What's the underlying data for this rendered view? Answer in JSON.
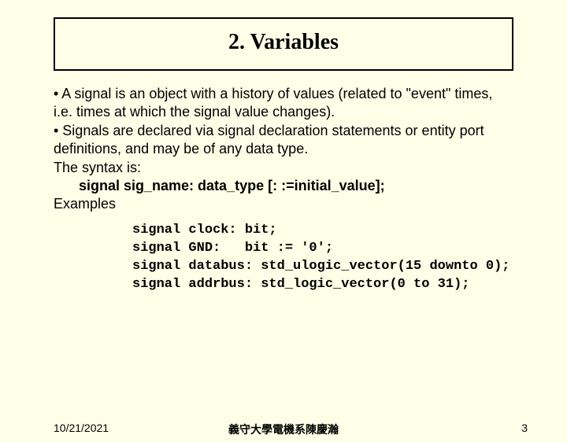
{
  "title": "2. Variables",
  "bullets": {
    "line1": "• A signal is an object with a history of values (related to \"event\" times, i.e. times at which the signal value changes).",
    "line2": "• Signals are declared via signal declaration statements or entity port definitions, and may be of any data type.",
    "line3": "The syntax is:",
    "syntax": "signal sig_name: data_type [: :=initial_value];",
    "line4": "Examples"
  },
  "code": "signal clock: bit;\nsignal GND:   bit := '0';\nsignal databus: std_ulogic_vector(15 downto 0);\nsignal addrbus: std_logic_vector(0 to 31);",
  "footer": {
    "date": "10/21/2021",
    "center": "義守大學電機系陳慶瀚",
    "page": "3"
  }
}
